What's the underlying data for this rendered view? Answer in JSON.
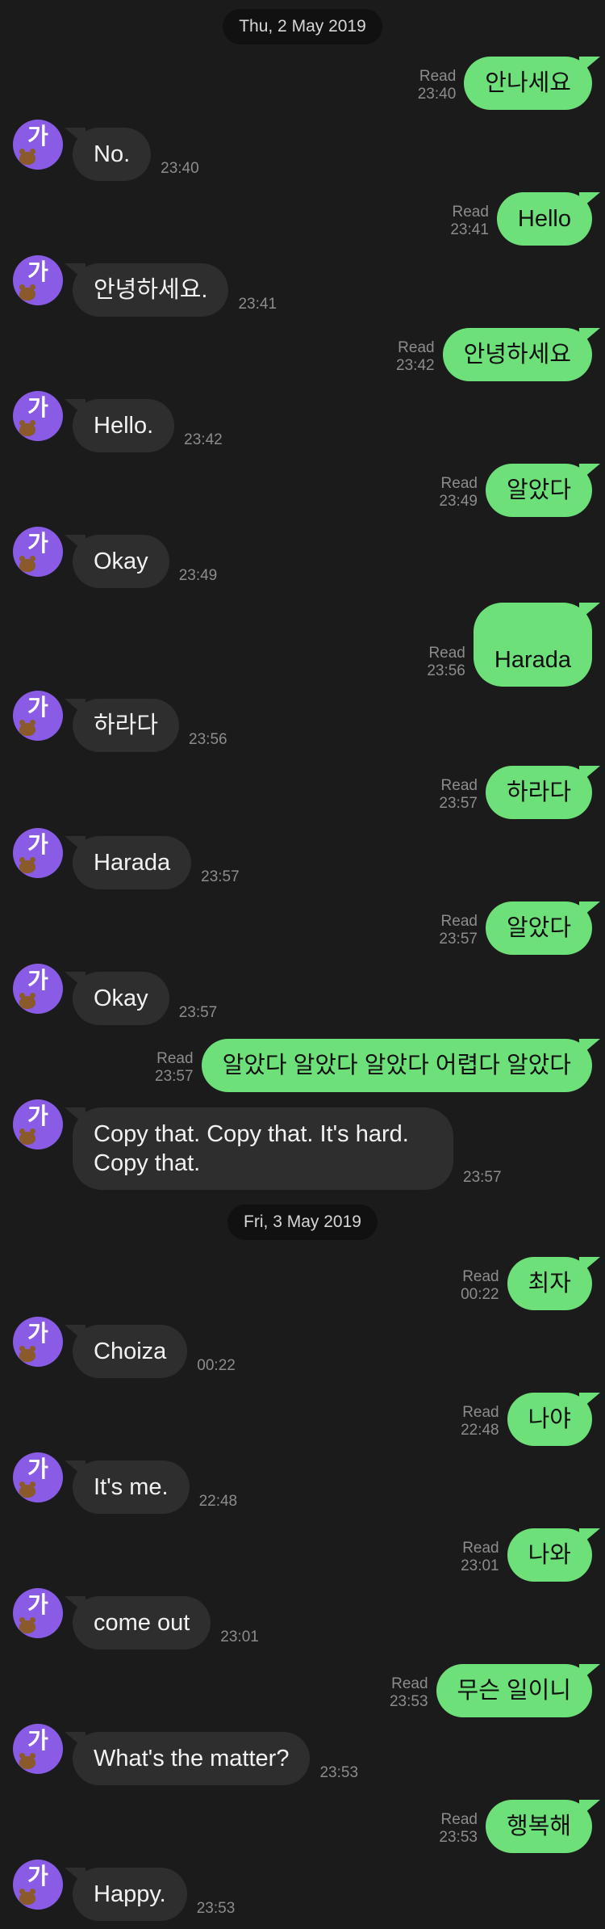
{
  "dates": [
    "Thu, 2 May 2019",
    "Fri, 3 May 2019"
  ],
  "avatar": {
    "glyph": "가",
    "color": "#8a5ce6",
    "icon": "bear-icon"
  },
  "messages": [
    {
      "dir": "out",
      "text": "안나세요",
      "status": "Read",
      "time": "23:40"
    },
    {
      "dir": "in",
      "text": "No.",
      "time": "23:40"
    },
    {
      "dir": "out",
      "text": "Hello",
      "status": "Read",
      "time": "23:41"
    },
    {
      "dir": "in",
      "text": "안녕하세요.",
      "time": "23:41"
    },
    {
      "dir": "out",
      "text": "안녕하세요",
      "status": "Read",
      "time": "23:42"
    },
    {
      "dir": "in",
      "text": "Hello.",
      "time": "23:42"
    },
    {
      "dir": "out",
      "text": "알았다",
      "status": "Read",
      "time": "23:49"
    },
    {
      "dir": "in",
      "text": "Okay",
      "time": "23:49"
    },
    {
      "dir": "out",
      "text": "Harada",
      "status": "Read",
      "time": "23:56"
    },
    {
      "dir": "in",
      "text": "하라다",
      "time": "23:56"
    },
    {
      "dir": "out",
      "text": "하라다",
      "status": "Read",
      "time": "23:57"
    },
    {
      "dir": "in",
      "text": "Harada",
      "time": "23:57"
    },
    {
      "dir": "out",
      "text": "알았다",
      "status": "Read",
      "time": "23:57"
    },
    {
      "dir": "in",
      "text": "Okay",
      "time": "23:57"
    },
    {
      "dir": "out",
      "text": "알았다 알았다 알았다 어렵다 알았다",
      "status": "Read",
      "time": "23:57"
    },
    {
      "dir": "in",
      "text": "Copy that. Copy that. It's hard. Copy that.",
      "time": "23:57"
    },
    {
      "dir": "out",
      "text": "최자",
      "status": "Read",
      "time": "00:22"
    },
    {
      "dir": "in",
      "text": "Choiza",
      "time": "00:22"
    },
    {
      "dir": "out",
      "text": "나야",
      "status": "Read",
      "time": "22:48"
    },
    {
      "dir": "in",
      "text": "It's me.",
      "time": "22:48"
    },
    {
      "dir": "out",
      "text": "나와",
      "status": "Read",
      "time": "23:01"
    },
    {
      "dir": "in",
      "text": "come out",
      "time": "23:01"
    },
    {
      "dir": "out",
      "text": "무슨 일이니",
      "status": "Read",
      "time": "23:53"
    },
    {
      "dir": "in",
      "text": "What's the matter?",
      "time": "23:53"
    },
    {
      "dir": "out",
      "text": "행복해",
      "status": "Read",
      "time": "23:53"
    },
    {
      "dir": "in",
      "text": "Happy.",
      "time": "23:53"
    }
  ],
  "colors": {
    "background": "#1b1b1b",
    "sent_bubble": "#6de07a",
    "received_bubble": "#2e2e2e"
  }
}
